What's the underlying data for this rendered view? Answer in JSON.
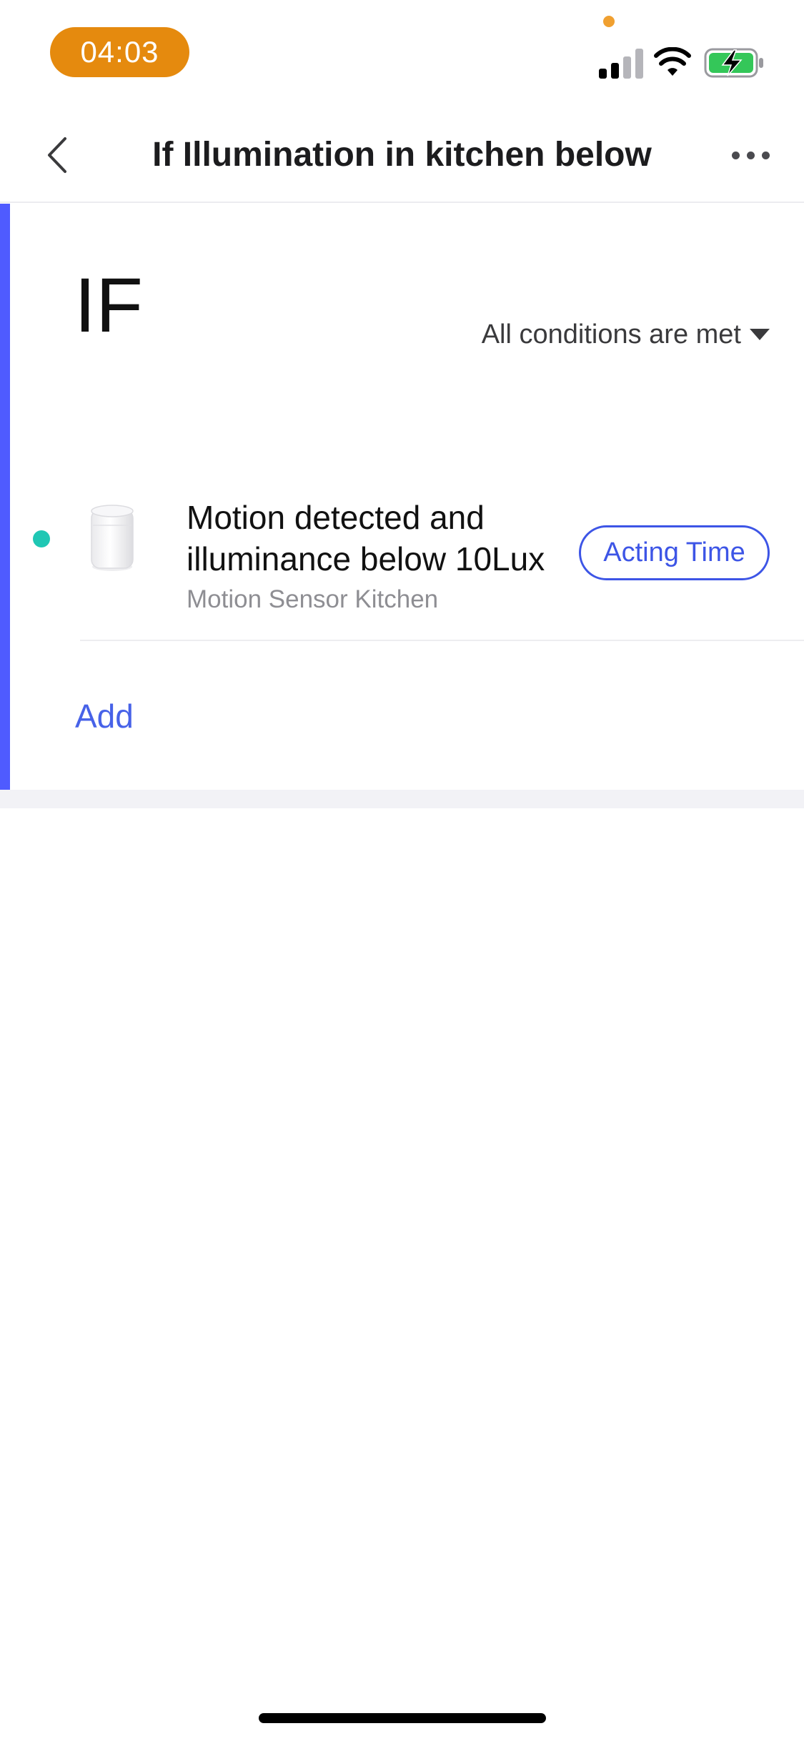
{
  "status_bar": {
    "time": "04:03",
    "signal_icon": "cellular-signal-icon",
    "wifi_icon": "wifi-icon",
    "battery_icon": "battery-charging-icon",
    "time_pill_color": "#e58a0e",
    "battery_color": "#34c759"
  },
  "nav": {
    "back_icon": "chevron-left-icon",
    "title": "If Illumination in kitchen below",
    "more_icon": "more-horizontal-icon"
  },
  "if_section": {
    "heading": "IF",
    "condition_mode": "All conditions are met",
    "condition_mode_icon": "caret-down-icon",
    "accent_color": "#4f5bff",
    "conditions": [
      {
        "title": "Motion detected and illuminance below 10Lux",
        "device": "Motion Sensor Kitchen",
        "device_icon": "motion-sensor-icon",
        "status_color": "#1fc7b4",
        "action_label": "Acting Time"
      }
    ],
    "add_label": "Add"
  },
  "link_color": "#3d55e6"
}
